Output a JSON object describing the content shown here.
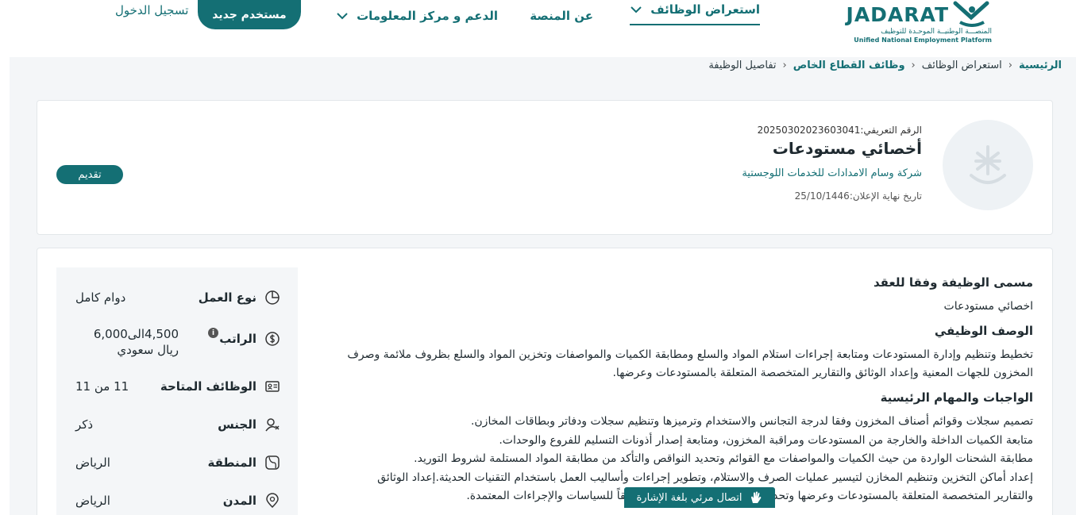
{
  "header": {
    "logo_word": "JADARAT",
    "logo_ar": "المنصـــة الوطنيــة الموحـدة للتوظيف",
    "logo_en": "Unified National Employment Platform",
    "nav": {
      "jobs": "استعراض الوظائف",
      "about": "عن المنصة",
      "support": "الدعم و مركز المعلومات"
    },
    "new_user": "مستخدم جديد",
    "login": "تسجيل الدخول"
  },
  "breadcrumb": {
    "home": "الرئيسية",
    "jobs": "استعراض الوظائف",
    "private": "وظائف القطاع الخاص",
    "current": "تفاصيل الوظيفة"
  },
  "job": {
    "id_label": "الرقم التعريفي:",
    "id_value": "20250302023603041",
    "title": "أخصائي مستودعات",
    "company": "شركة وسام الامدادات للخدمات اللوجستية",
    "deadline_label": "تاريخ نهاية الإعلان:",
    "deadline_value": "25/10/1446",
    "apply": "تقديم"
  },
  "details": [
    {
      "icon": "clock-icon",
      "label": "نوع العمل",
      "value": "دوام كامل"
    },
    {
      "icon": "money-icon",
      "label": "الراتب",
      "value": "4,500الى6,000 ريال سعودي"
    },
    {
      "icon": "id-card-icon",
      "label": "الوظائف المتاحة",
      "value": "11 من 11"
    },
    {
      "icon": "gender-icon",
      "label": "الجنس",
      "value": "ذكر"
    },
    {
      "icon": "map-icon",
      "label": "المنطقة",
      "value": "الرياض"
    },
    {
      "icon": "location-pin-icon",
      "label": "المدن",
      "value": "الرياض"
    }
  ],
  "description": {
    "contract_title_label": "مسمى الوظيفة وفقا للعقد",
    "contract_title_value": "اخصائي مستودعات",
    "desc_label": "الوصف الوظيفي",
    "desc_value": "تخطيط وتنظيم وإدارة المستودعات ومتابعة إجراءات استلام المواد والسلع ومطابقة الكميات والمواصفات وتخزين المواد والسلع بظروف ملائمة وصرف المخزون للجهات المعنية وإعداد الوثائق والتقارير المتخصصة المتعلقة بالمستودعات وعرضها.",
    "duties_label": "الواجبات والمهام الرئيسية",
    "duties": [
      "تصميم سجلات وقوائم أصناف المخزون وفقا لدرجة التجانس والاستخدام وترميزها وتنظيم سجلات ودفاتر وبطاقات المخازن.",
      "متابعة الكميات الداخلة والخارجة من المستودعات ومراقبة المخزون، ومتابعة إصدار أذونات التسليم للفروع والوحدات.",
      "مطابقة الشحنات الواردة من حيث الكميات والمواصفات مع القوائم وتحديد النواقص والتأكد من مطابقة المواد المستلمة لشروط التوريد.",
      "إعداد أماكن التخزين وتنظيم المخازن لتيسير عمليات الصرف والاستلام، وتطوير إجراءات وأساليب العمل باستخدام التقنيات الحديثة.إعداد الوثائق",
      "والتقارير المتخصصة المتعلقة بالمستودعات وعرضها وتحديث قاعدة البيانات الخاصة بها وفقاً للسياسات والإجراءات المعتمدة."
    ]
  },
  "sign_language": "اتصال مرئي بلغة الإشارة",
  "colors": {
    "brand": "#146f74",
    "background": "#f4f6f8"
  }
}
